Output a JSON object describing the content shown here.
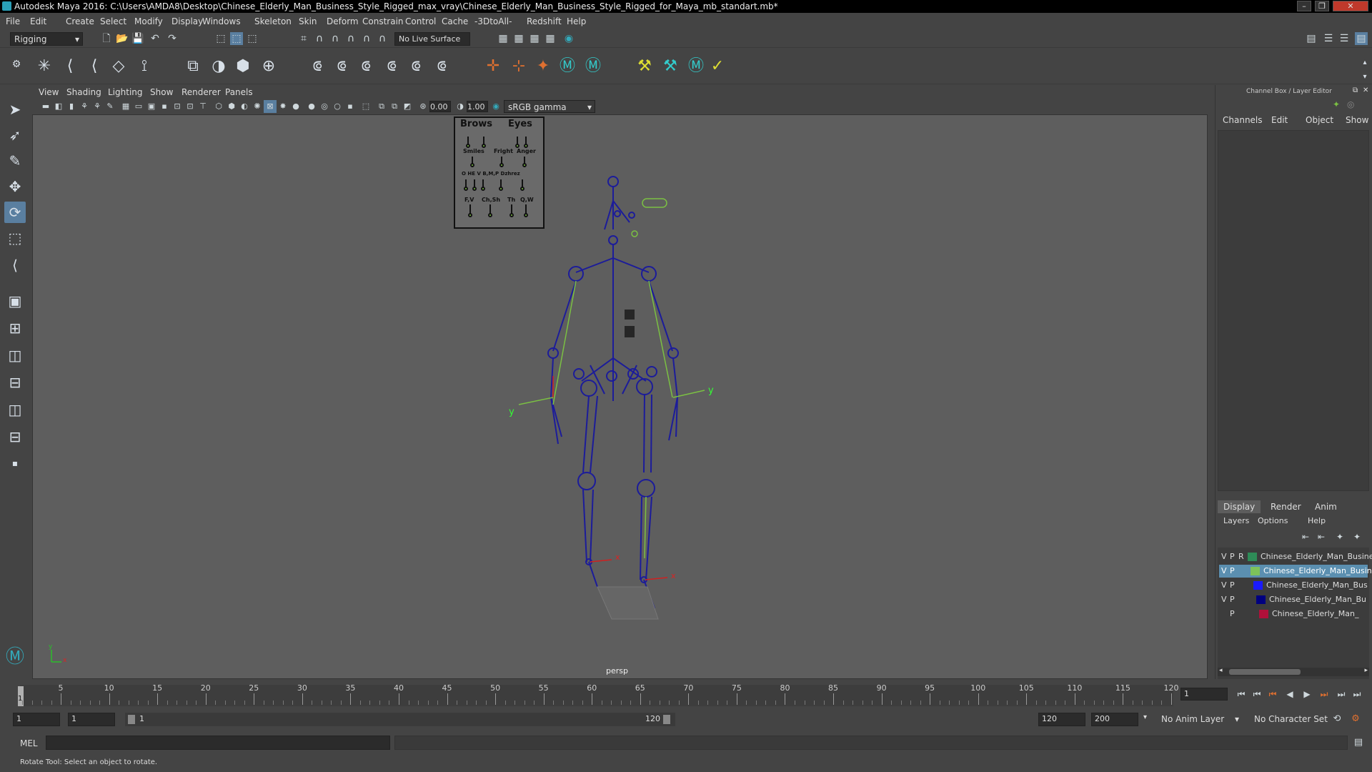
{
  "window": {
    "title": "Autodesk Maya 2016: C:\\Users\\AMDA8\\Desktop\\Chinese_Elderly_Man_Business_Style_Rigged_max_vray\\Chinese_Elderly_Man_Business_Style_Rigged_for_Maya_mb_standart.mb*"
  },
  "menubar": [
    "File",
    "Edit",
    "Create",
    "Select",
    "Modify",
    "Display",
    "Windows",
    "Skeleton",
    "Skin",
    "Deform",
    "Constrain",
    "Control",
    "Cache",
    "-3DtoAll-",
    "Redshift",
    "Help"
  ],
  "statusline": {
    "mode": "Rigging",
    "live_surface": "No Live Surface"
  },
  "viewport": {
    "menus": [
      "View",
      "Shading",
      "Lighting",
      "Show",
      "Renderer",
      "Panels"
    ],
    "exposure": "0.00",
    "gamma": "1.00",
    "colorspace": "sRGB gamma",
    "camera_label": "persp",
    "face_panel": {
      "brows": "Brows",
      "eyes": "Eyes",
      "row2": [
        "Smiles",
        "Fright",
        "Anger"
      ],
      "row3": "O HE V B,M,P Dzhrez",
      "row4": [
        "F,V",
        "Ch,Sh",
        "Th",
        "Q,W"
      ]
    }
  },
  "channelbox": {
    "title": "Channel Box / Layer Editor",
    "menus": [
      "Channels",
      "Edit",
      "Object",
      "Show"
    ],
    "tabs": [
      "Display",
      "Render",
      "Anim"
    ],
    "layer_menus": [
      "Layers",
      "Options",
      "Help"
    ],
    "layers": [
      {
        "v": "V",
        "p": "P",
        "r": "R",
        "color": "#2e8b57",
        "name": "Chinese_Elderly_Man_Busine",
        "selected": false
      },
      {
        "v": "V",
        "p": "P",
        "r": "",
        "color": "#7dc25a",
        "name": "Chinese_Elderly_Man_Busine",
        "selected": true
      },
      {
        "v": "V",
        "p": "P",
        "r": "",
        "color": "#1a1aff",
        "name": "Chinese_Elderly_Man_Bus",
        "selected": false
      },
      {
        "v": "V",
        "p": "P",
        "r": "",
        "color": "#000080",
        "name": "Chinese_Elderly_Man_Bu",
        "selected": false
      },
      {
        "v": "",
        "p": "P",
        "r": "",
        "color": "#b0103a",
        "name": "Chinese_Elderly_Man_",
        "selected": false
      }
    ]
  },
  "timeline": {
    "ticks": [
      5,
      10,
      15,
      20,
      25,
      30,
      35,
      40,
      45,
      50,
      55,
      60,
      65,
      70,
      75,
      80,
      85,
      90,
      95,
      100,
      105,
      110,
      115,
      120
    ],
    "current_frame": "1",
    "current_frame_field": "1"
  },
  "range": {
    "start": "1",
    "playback_start": "1",
    "slider_start": "1",
    "slider_end": "120",
    "playback_end": "120",
    "end": "200",
    "anim_layer": "No Anim Layer",
    "character_set": "No Character Set"
  },
  "command": {
    "label": "MEL"
  },
  "help": {
    "text": "Rotate Tool: Select an object to rotate."
  },
  "axis": {
    "y": "y",
    "x": "x"
  }
}
